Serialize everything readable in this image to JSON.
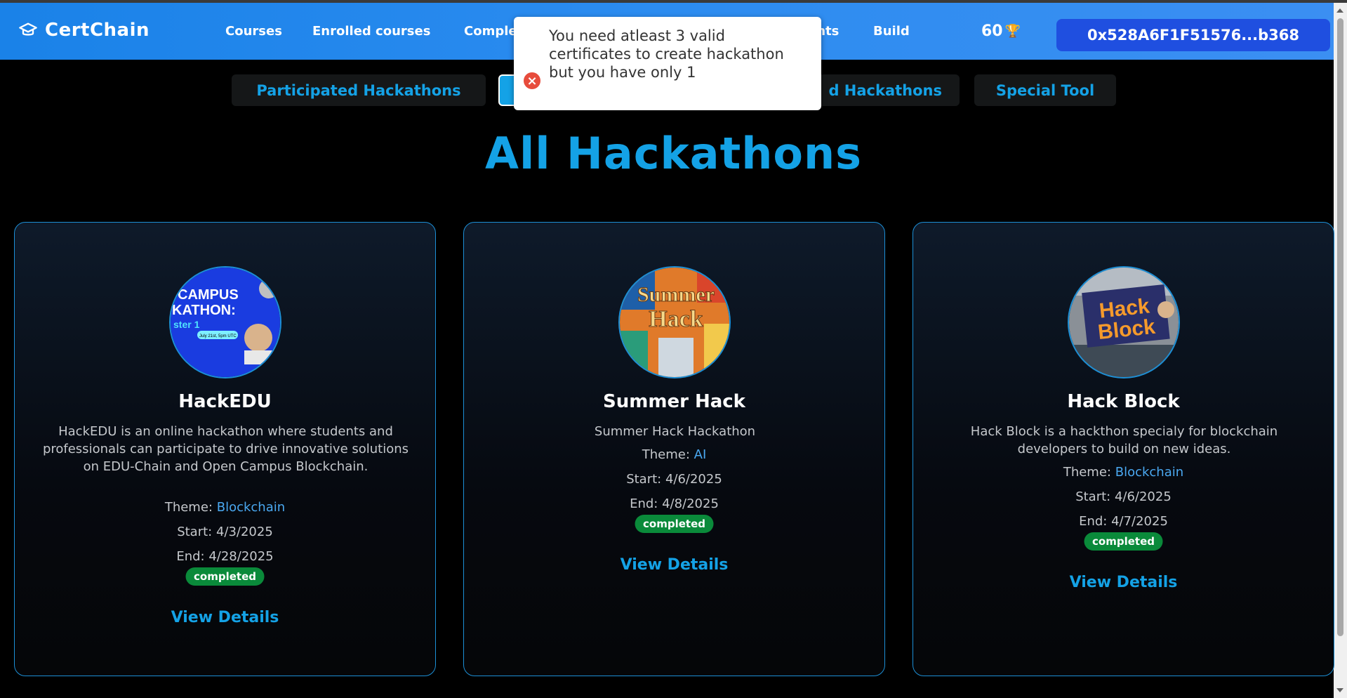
{
  "navbar": {
    "brand": "CertChain",
    "links": {
      "courses": "Courses",
      "enrolled": "Enrolled courses",
      "completed": "Comple",
      "events": "ents",
      "build": "Build"
    },
    "points": "60",
    "wallet": "0x528A6F1F51576...b368",
    "color": "#2c8cf0"
  },
  "tabs": {
    "participated": "Participated Hackathons",
    "all": "",
    "created": "d Hackathons",
    "special": "Special Tool"
  },
  "toast": {
    "message": "You need atleast 3 valid certificates to create hackathon but you have only 1"
  },
  "page_title": "All Hackathons",
  "hackathons": [
    {
      "title": "HackEDU",
      "image_text": [
        "CAMPUS",
        "KATHON:",
        "ster 1",
        "July 21st, 5pm UTC"
      ],
      "description": "HackEDU is an online hackathon where students and professionals can participate to drive innovative solutions on EDU-Chain and Open Campus Blockchain.",
      "theme_label": "Theme:",
      "theme": "Blockchain",
      "start": "Start: 4/3/2025",
      "end": "End: 4/28/2025",
      "status": "completed",
      "action": "View Details"
    },
    {
      "title": "Summer Hack",
      "image_text": [
        "Summer",
        "Hack"
      ],
      "description": "Summer Hack Hackathon",
      "theme_label": "Theme:",
      "theme": "AI",
      "start": "Start: 4/6/2025",
      "end": "End: 4/8/2025",
      "status": "completed",
      "action": "View Details"
    },
    {
      "title": "Hack Block",
      "image_text": [
        "Hack",
        "Block"
      ],
      "description": "Hack Block is a hackthon specialy for blockchain developers to build on new ideas.",
      "theme_label": "Theme:",
      "theme": "Blockchain",
      "start": "Start: 4/6/2025",
      "end": "End: 4/7/2025",
      "status": "completed",
      "action": "View Details"
    }
  ],
  "colors": {
    "accent": "#14a2e6",
    "badge": "#0a8a3a",
    "error": "#e74c3c"
  }
}
